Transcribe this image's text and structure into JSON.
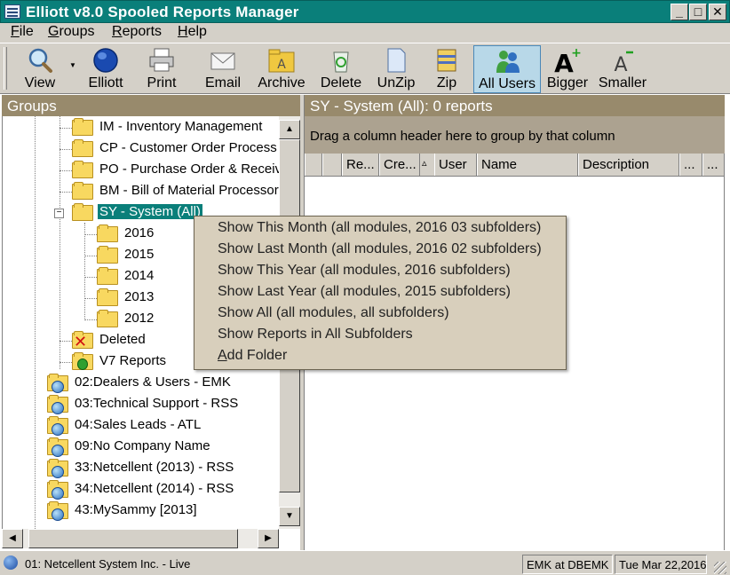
{
  "window": {
    "title": "Elliott v8.0 Spooled Reports Manager",
    "min_glyph": "_",
    "max_glyph": "□",
    "close_glyph": "✕"
  },
  "menubar": {
    "items": [
      {
        "label": "File",
        "accel": "F",
        "rest": "ile"
      },
      {
        "label": "Groups",
        "accel": "G",
        "rest": "roups"
      },
      {
        "label": "Reports",
        "accel": "R",
        "rest": "eports"
      },
      {
        "label": "Help",
        "accel": "H",
        "rest": "elp"
      }
    ]
  },
  "toolbar": {
    "view": "View",
    "elliott": "Elliott",
    "print": "Print",
    "email": "Email",
    "archive": "Archive",
    "delete": "Delete",
    "unzip": "UnZip",
    "zip": "Zip",
    "all_users": "All Users",
    "bigger": "Bigger",
    "smaller": "Smaller"
  },
  "left_pane": {
    "header": "Groups",
    "tree": [
      {
        "label": "IM - Inventory Management",
        "icon": "folder"
      },
      {
        "label": "CP - Customer Order Process",
        "icon": "folder"
      },
      {
        "label": "PO - Purchase Order & Receiv",
        "icon": "folder"
      },
      {
        "label": "BM - Bill of Material Processor",
        "icon": "folder"
      },
      {
        "label": "SY - System (All)",
        "icon": "folder-open",
        "selected": true
      },
      {
        "label": "2016",
        "icon": "folder"
      },
      {
        "label": "2015",
        "icon": "folder"
      },
      {
        "label": "2014",
        "icon": "folder"
      },
      {
        "label": "2013",
        "icon": "folder"
      },
      {
        "label": "2012",
        "icon": "folder"
      },
      {
        "label": "Deleted",
        "icon": "folder-deleted"
      },
      {
        "label": "V7 Reports",
        "icon": "folder-v7"
      },
      {
        "label": "02:Dealers & Users - EMK",
        "icon": "folder-globe"
      },
      {
        "label": "03:Technical Support - RSS",
        "icon": "folder-globe"
      },
      {
        "label": "04:Sales Leads - ATL",
        "icon": "folder-globe"
      },
      {
        "label": "09:No Company Name",
        "icon": "folder-globe"
      },
      {
        "label": "33:Netcellent (2013) - RSS",
        "icon": "folder-globe"
      },
      {
        "label": "34:Netcellent (2014) - RSS",
        "icon": "folder-globe"
      },
      {
        "label": "43:MySammy [2013]",
        "icon": "folder-globe"
      }
    ]
  },
  "right_pane": {
    "header": "SY - System (All):  0 reports",
    "group_hint": "Drag a column header here to group by that column",
    "columns": [
      {
        "label": ""
      },
      {
        "label": ""
      },
      {
        "label": "Re..."
      },
      {
        "label": "Cre..."
      },
      {
        "label": "▵"
      },
      {
        "label": "User"
      },
      {
        "label": "Name"
      },
      {
        "label": "Description"
      },
      {
        "label": "..."
      },
      {
        "label": "..."
      }
    ]
  },
  "context_menu": {
    "items": [
      {
        "label": "Show This Month (all modules, 2016 03 subfolders)"
      },
      {
        "label": "Show Last Month (all modules, 2016 02 subfolders)"
      },
      {
        "label": "Show This Year (all modules, 2016 subfolders)"
      },
      {
        "label": "Show Last Year (all modules, 2015 subfolders)"
      },
      {
        "label": "Show All (all modules, all subfolders)"
      },
      {
        "label": "Show Reports in All Subfolders"
      },
      {
        "label": "Add Folder",
        "accel": "A",
        "rest": "dd Folder"
      }
    ]
  },
  "statusbar": {
    "company": "01: Netcellent System Inc. - Live",
    "user_db": "EMK at DBEMK",
    "date": "Tue Mar 22,2016"
  },
  "colors": {
    "titlebar": "#0a7f7a",
    "pane_header": "#988a6c",
    "group_bar": "#aca290",
    "menu_bg": "#d8cfbc",
    "selection": "#0a7f7a"
  }
}
